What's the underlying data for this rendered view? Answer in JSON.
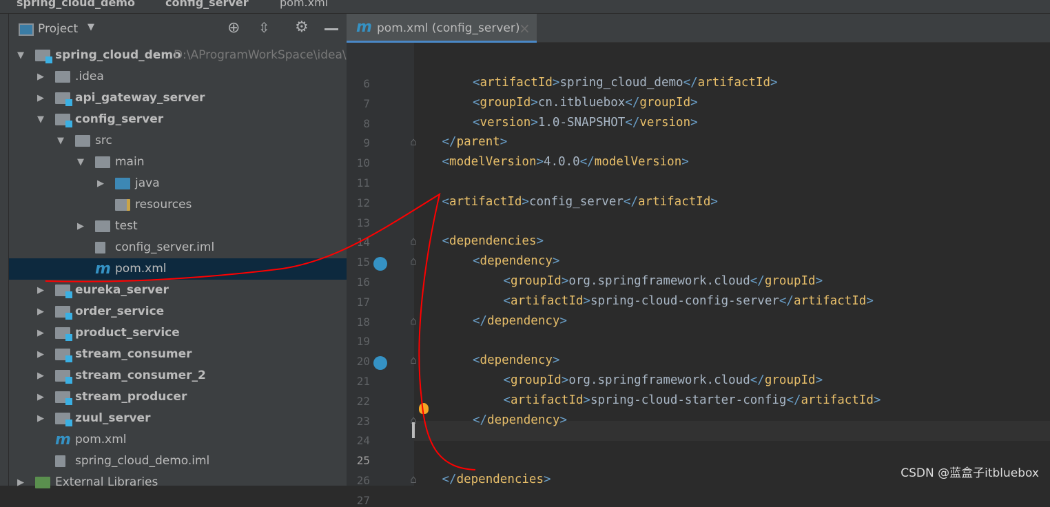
{
  "breadcrumb": [
    "spring_cloud_demo",
    "config_server",
    "pom.xml"
  ],
  "project_panel": {
    "title": "Project",
    "icons": [
      "locate-icon",
      "collapse-all-icon",
      "gear-icon",
      "minimize-icon"
    ]
  },
  "tree": [
    {
      "label": "spring_cloud_demo",
      "path": "D:\\AProgramWorkSpace\\idea\\s",
      "level": 0,
      "type": "module",
      "arrow": "down",
      "bold": true
    },
    {
      "label": ".idea",
      "level": 1,
      "type": "folder",
      "arrow": "right"
    },
    {
      "label": "api_gateway_server",
      "level": 1,
      "type": "module",
      "arrow": "right",
      "bold": true
    },
    {
      "label": "config_server",
      "level": 1,
      "type": "module",
      "arrow": "down",
      "bold": true
    },
    {
      "label": "src",
      "level": 2,
      "type": "folder",
      "arrow": "down"
    },
    {
      "label": "main",
      "level": 3,
      "type": "folder",
      "arrow": "down"
    },
    {
      "label": "java",
      "level": 4,
      "type": "source-folder",
      "arrow": "right"
    },
    {
      "label": "resources",
      "level": 4,
      "type": "resources-folder"
    },
    {
      "label": "test",
      "level": 3,
      "type": "folder",
      "arrow": "right"
    },
    {
      "label": "config_server.iml",
      "level": 3,
      "type": "iml"
    },
    {
      "label": "pom.xml",
      "level": 3,
      "type": "maven",
      "selected": true
    },
    {
      "label": "eureka_server",
      "level": 1,
      "type": "module",
      "arrow": "right",
      "bold": true
    },
    {
      "label": "order_service",
      "level": 1,
      "type": "module",
      "arrow": "right",
      "bold": true
    },
    {
      "label": "product_service",
      "level": 1,
      "type": "module",
      "arrow": "right",
      "bold": true
    },
    {
      "label": "stream_consumer",
      "level": 1,
      "type": "module",
      "arrow": "right",
      "bold": true
    },
    {
      "label": "stream_consumer_2",
      "level": 1,
      "type": "module",
      "arrow": "right",
      "bold": true
    },
    {
      "label": "stream_producer",
      "level": 1,
      "type": "module",
      "arrow": "right",
      "bold": true
    },
    {
      "label": "zuul_server",
      "level": 1,
      "type": "module",
      "arrow": "right",
      "bold": true
    },
    {
      "label": "pom.xml",
      "level": 1,
      "type": "maven"
    },
    {
      "label": "spring_cloud_demo.iml",
      "level": 1,
      "type": "iml"
    },
    {
      "label": "External Libraries",
      "level": 0,
      "type": "libraries",
      "arrow": "right"
    }
  ],
  "editor": {
    "tab": {
      "label": "pom.xml (config_server)",
      "icon": "maven-icon",
      "close": "×"
    },
    "lines": [
      {
        "n": 6,
        "indent": 2,
        "tag": "artifactId",
        "text": "spring_cloud_demo"
      },
      {
        "n": 7,
        "indent": 2,
        "tag": "groupId",
        "text": "cn.itbluebox"
      },
      {
        "n": 8,
        "indent": 2,
        "tag": "version",
        "text": "1.0-SNAPSHOT"
      },
      {
        "n": 9,
        "indent": 1,
        "close": "parent"
      },
      {
        "n": 10,
        "indent": 1,
        "tag": "modelVersion",
        "text": "4.0.0"
      },
      {
        "n": 11
      },
      {
        "n": 12,
        "indent": 1,
        "tag": "artifactId",
        "text": "config_server"
      },
      {
        "n": 13
      },
      {
        "n": 14,
        "indent": 1,
        "open": "dependencies"
      },
      {
        "n": 15,
        "indent": 2,
        "open": "dependency"
      },
      {
        "n": 16,
        "indent": 3,
        "tag": "groupId",
        "text": "org.springframework.cloud"
      },
      {
        "n": 17,
        "indent": 3,
        "tag": "artifactId",
        "text": "spring-cloud-config-server"
      },
      {
        "n": 18,
        "indent": 2,
        "close": "dependency"
      },
      {
        "n": 19
      },
      {
        "n": 20,
        "indent": 2,
        "open": "dependency"
      },
      {
        "n": 21,
        "indent": 3,
        "tag": "groupId",
        "text": "org.springframework.cloud"
      },
      {
        "n": 22,
        "indent": 3,
        "tag": "artifactId",
        "text": "spring-cloud-starter-config"
      },
      {
        "n": 23,
        "indent": 2,
        "close": "dependency"
      },
      {
        "n": 24
      },
      {
        "n": 25
      },
      {
        "n": 26,
        "indent": 1,
        "close": "dependencies"
      },
      {
        "n": 27
      }
    ]
  },
  "watermark": "CSDN @蓝盒子itbluebox",
  "colors": {
    "annotation": "#ff0000",
    "selection": "#0d293e",
    "accent": "#4a88c7"
  }
}
